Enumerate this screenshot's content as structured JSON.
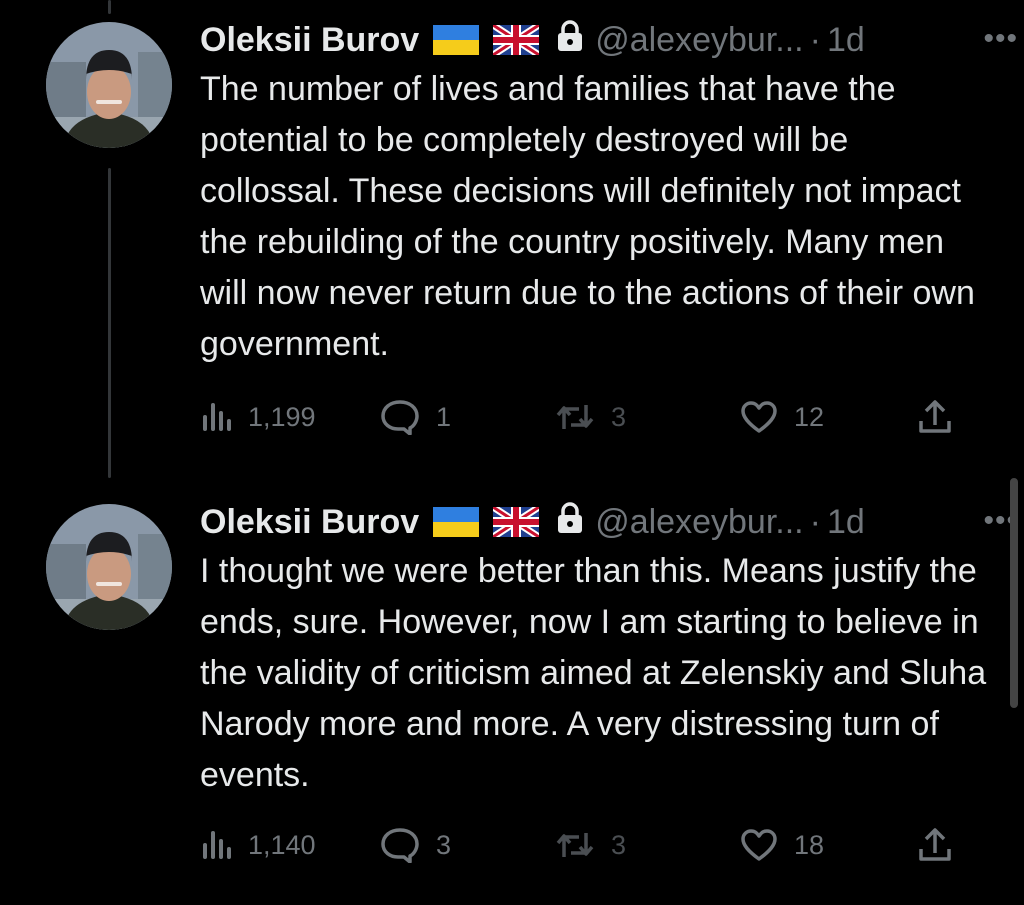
{
  "tweets": [
    {
      "author_name": "Oleksii Burov",
      "handle": "@alexeybur...",
      "separator": "·",
      "time": "1d",
      "more": "•••",
      "text": "The number of lives and families that have the potential to be completely destroyed will be collossal. These decisions will definitely not impact the rebuilding of the country positively. Many men will now never return due to the actions of their own government.",
      "views": "1,199",
      "replies": "1",
      "retweets": "3",
      "likes": "12"
    },
    {
      "author_name": "Oleksii Burov",
      "handle": "@alexeybur...",
      "separator": "·",
      "time": "1d",
      "more": "•••",
      "text": "I thought we were better than this. Means justify the ends, sure. However, now I am starting to believe in the validity of criticism aimed at Zelenskiy and Sluha Narody more and more. A very distressing turn of events.",
      "views": "1,140",
      "replies": "3",
      "retweets": "3",
      "likes": "18"
    }
  ],
  "icons": {
    "views": "views-chart-icon",
    "reply": "speech-bubble-icon",
    "retweet": "retweet-arrows-icon",
    "like": "heart-icon",
    "share": "share-upload-icon",
    "lock": "lock-icon",
    "flag_ua": "ukraine-flag-icon",
    "flag_uk": "uk-flag-icon"
  },
  "colors": {
    "background": "#000000",
    "text": "#e7e9ea",
    "secondary": "#71767b"
  }
}
